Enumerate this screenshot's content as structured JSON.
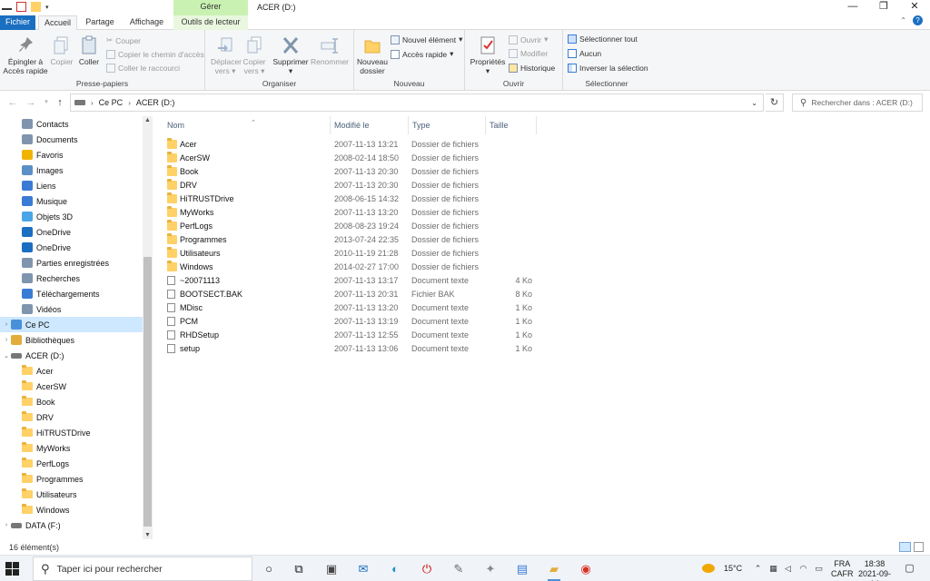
{
  "window": {
    "title": "ACER (D:)",
    "context_group": "Gérer",
    "minimize": "—",
    "maximize": "❐",
    "close": "✕"
  },
  "tabs": [
    {
      "label": "Fichier"
    },
    {
      "label": "Accueil"
    },
    {
      "label": "Partage"
    },
    {
      "label": "Affichage"
    },
    {
      "label": "Outils de lecteur"
    }
  ],
  "ribbon": {
    "presse_papiers": {
      "label": "Presse-papiers",
      "pin_line1": "Épingler à",
      "pin_line2": "Accès rapide",
      "copy": "Copier",
      "paste": "Coller",
      "cut": "Couper",
      "copy_path": "Copier le chemin d'accès",
      "paste_shortcut": "Coller le raccourci"
    },
    "organiser": {
      "label": "Organiser",
      "move_line1": "Déplacer",
      "move_line2": "vers",
      "copyto_line1": "Copier",
      "copyto_line2": "vers",
      "delete": "Supprimer",
      "rename": "Renommer"
    },
    "nouveau": {
      "label": "Nouveau",
      "new_folder_line1": "Nouveau",
      "new_folder_line2": "dossier",
      "new_item": "Nouvel élément",
      "easy_access": "Accès rapide"
    },
    "ouvrir": {
      "label": "Ouvrir",
      "properties": "Propriétés",
      "open": "Ouvrir",
      "edit": "Modifier",
      "history": "Historique"
    },
    "selectionner": {
      "label": "Sélectionner",
      "select_all": "Sélectionner tout",
      "select_none": "Aucun",
      "invert": "Inverser la sélection"
    }
  },
  "address": {
    "crumb1": "Ce PC",
    "crumb2": "ACER (D:)",
    "search_placeholder": "Rechercher dans : ACER (D:)"
  },
  "nav": [
    {
      "label": "Contacts",
      "icon": "contacts-icon",
      "level": 1
    },
    {
      "label": "Documents",
      "icon": "documents-icon",
      "level": 1
    },
    {
      "label": "Favoris",
      "icon": "star-icon",
      "level": 1
    },
    {
      "label": "Images",
      "icon": "images-icon",
      "level": 1
    },
    {
      "label": "Liens",
      "icon": "link-icon",
      "level": 1
    },
    {
      "label": "Musique",
      "icon": "music-icon",
      "level": 1
    },
    {
      "label": "Objets 3D",
      "icon": "cube-icon",
      "level": 1
    },
    {
      "label": "OneDrive",
      "icon": "cloud-icon",
      "level": 1
    },
    {
      "label": "OneDrive",
      "icon": "cloud-icon",
      "level": 1
    },
    {
      "label": "Parties enregistrées",
      "icon": "saved-games-icon",
      "level": 1
    },
    {
      "label": "Recherches",
      "icon": "search-icon",
      "level": 1
    },
    {
      "label": "Téléchargements",
      "icon": "download-icon",
      "level": 1
    },
    {
      "label": "Vidéos",
      "icon": "video-icon",
      "level": 1
    },
    {
      "label": "Ce PC",
      "icon": "computer-icon",
      "level": 0,
      "selected": true
    },
    {
      "label": "Bibliothèques",
      "icon": "library-icon",
      "level": 0
    },
    {
      "label": "ACER (D:)",
      "icon": "drive-icon",
      "level": 0,
      "expanded": true
    },
    {
      "label": "Acer",
      "icon": "folder-icon",
      "level": 1
    },
    {
      "label": "AcerSW",
      "icon": "folder-icon",
      "level": 1
    },
    {
      "label": "Book",
      "icon": "folder-icon",
      "level": 1
    },
    {
      "label": "DRV",
      "icon": "folder-icon",
      "level": 1
    },
    {
      "label": "HiTRUSTDrive",
      "icon": "folder-icon",
      "level": 1
    },
    {
      "label": "MyWorks",
      "icon": "folder-icon",
      "level": 1
    },
    {
      "label": "PerfLogs",
      "icon": "folder-icon",
      "level": 1
    },
    {
      "label": "Programmes",
      "icon": "folder-icon",
      "level": 1
    },
    {
      "label": "Utilisateurs",
      "icon": "folder-icon",
      "level": 1
    },
    {
      "label": "Windows",
      "icon": "folder-icon",
      "level": 1
    },
    {
      "label": "DATA (F:)",
      "icon": "drive-icon",
      "level": 0
    }
  ],
  "columns": {
    "name": "Nom",
    "modified": "Modifié le",
    "type": "Type",
    "size": "Taille"
  },
  "files": [
    {
      "name": "Acer",
      "date": "2007-11-13 13:21",
      "type": "Dossier de fichiers",
      "size": "",
      "kind": "folder"
    },
    {
      "name": "AcerSW",
      "date": "2008-02-14 18:50",
      "type": "Dossier de fichiers",
      "size": "",
      "kind": "folder"
    },
    {
      "name": "Book",
      "date": "2007-11-13 20:30",
      "type": "Dossier de fichiers",
      "size": "",
      "kind": "folder"
    },
    {
      "name": "DRV",
      "date": "2007-11-13 20:30",
      "type": "Dossier de fichiers",
      "size": "",
      "kind": "folder"
    },
    {
      "name": "HiTRUSTDrive",
      "date": "2008-06-15 14:32",
      "type": "Dossier de fichiers",
      "size": "",
      "kind": "folder"
    },
    {
      "name": "MyWorks",
      "date": "2007-11-13 13:20",
      "type": "Dossier de fichiers",
      "size": "",
      "kind": "folder"
    },
    {
      "name": "PerfLogs",
      "date": "2008-08-23 19:24",
      "type": "Dossier de fichiers",
      "size": "",
      "kind": "folder"
    },
    {
      "name": "Programmes",
      "date": "2013-07-24 22:35",
      "type": "Dossier de fichiers",
      "size": "",
      "kind": "folder"
    },
    {
      "name": "Utilisateurs",
      "date": "2010-11-19 21:28",
      "type": "Dossier de fichiers",
      "size": "",
      "kind": "folder"
    },
    {
      "name": "Windows",
      "date": "2014-02-27 17:00",
      "type": "Dossier de fichiers",
      "size": "",
      "kind": "folder"
    },
    {
      "name": "~20071113",
      "date": "2007-11-13 13:17",
      "type": "Document texte",
      "size": "4 Ko",
      "kind": "doc"
    },
    {
      "name": "BOOTSECT.BAK",
      "date": "2007-11-13 20:31",
      "type": "Fichier BAK",
      "size": "8 Ko",
      "kind": "doc"
    },
    {
      "name": "MDisc",
      "date": "2007-11-13 13:20",
      "type": "Document texte",
      "size": "1 Ko",
      "kind": "doc"
    },
    {
      "name": "PCM",
      "date": "2007-11-13 13:19",
      "type": "Document texte",
      "size": "1 Ko",
      "kind": "doc"
    },
    {
      "name": "RHDSetup",
      "date": "2007-11-13 12:55",
      "type": "Document texte",
      "size": "1 Ko",
      "kind": "doc"
    },
    {
      "name": "setup",
      "date": "2007-11-13 13:06",
      "type": "Document texte",
      "size": "1 Ko",
      "kind": "doc"
    }
  ],
  "status": {
    "count": "16 élément(s)"
  },
  "taskbar": {
    "search_placeholder": "Taper ici pour rechercher",
    "temperature": "15°C",
    "lang1": "FRA",
    "lang2": "CAFR",
    "time": "18:38",
    "date": "2021-09-14"
  },
  "colors": {
    "accent": "#1a6fc0",
    "context_tab": "#c9f1b2",
    "selection": "#cde8ff",
    "folder": "#ffd166"
  }
}
